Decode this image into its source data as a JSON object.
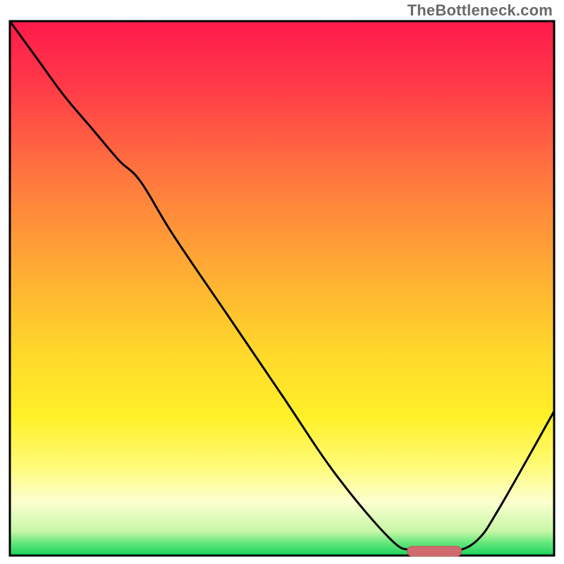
{
  "watermark": "TheBottleneck.com",
  "colors": {
    "border": "#000000",
    "curve": "#000000",
    "marker": "#cf6a6e",
    "marker_border": "#bf5a5e"
  },
  "chart_data": {
    "type": "line",
    "title": "",
    "xlabel": "",
    "ylabel": "",
    "xlim": [
      0,
      100
    ],
    "ylim": [
      0,
      100
    ],
    "series": [
      {
        "name": "bottleneck-curve",
        "x": [
          0,
          5,
          10,
          15,
          20,
          24,
          30,
          40,
          50,
          60,
          70,
          74,
          78,
          82,
          86,
          90,
          100
        ],
        "y": [
          100,
          93,
          86,
          80,
          74,
          70,
          60,
          45,
          30,
          15,
          3,
          1,
          0.5,
          0.8,
          3,
          9,
          27
        ]
      }
    ],
    "annotations": [
      {
        "name": "optimum-marker",
        "x_range": [
          73,
          83
        ],
        "y": 0.8
      }
    ],
    "background_gradient": [
      {
        "pos": 0.0,
        "color": "#ff1a4b"
      },
      {
        "pos": 0.12,
        "color": "#ff3a48"
      },
      {
        "pos": 0.3,
        "color": "#ff7a3e"
      },
      {
        "pos": 0.48,
        "color": "#ffb033"
      },
      {
        "pos": 0.62,
        "color": "#ffd82a"
      },
      {
        "pos": 0.74,
        "color": "#fff028"
      },
      {
        "pos": 0.83,
        "color": "#fffb75"
      },
      {
        "pos": 0.9,
        "color": "#fcffcf"
      },
      {
        "pos": 0.955,
        "color": "#c6f7a6"
      },
      {
        "pos": 0.975,
        "color": "#6ae87e"
      },
      {
        "pos": 1.0,
        "color": "#17d35a"
      }
    ]
  }
}
